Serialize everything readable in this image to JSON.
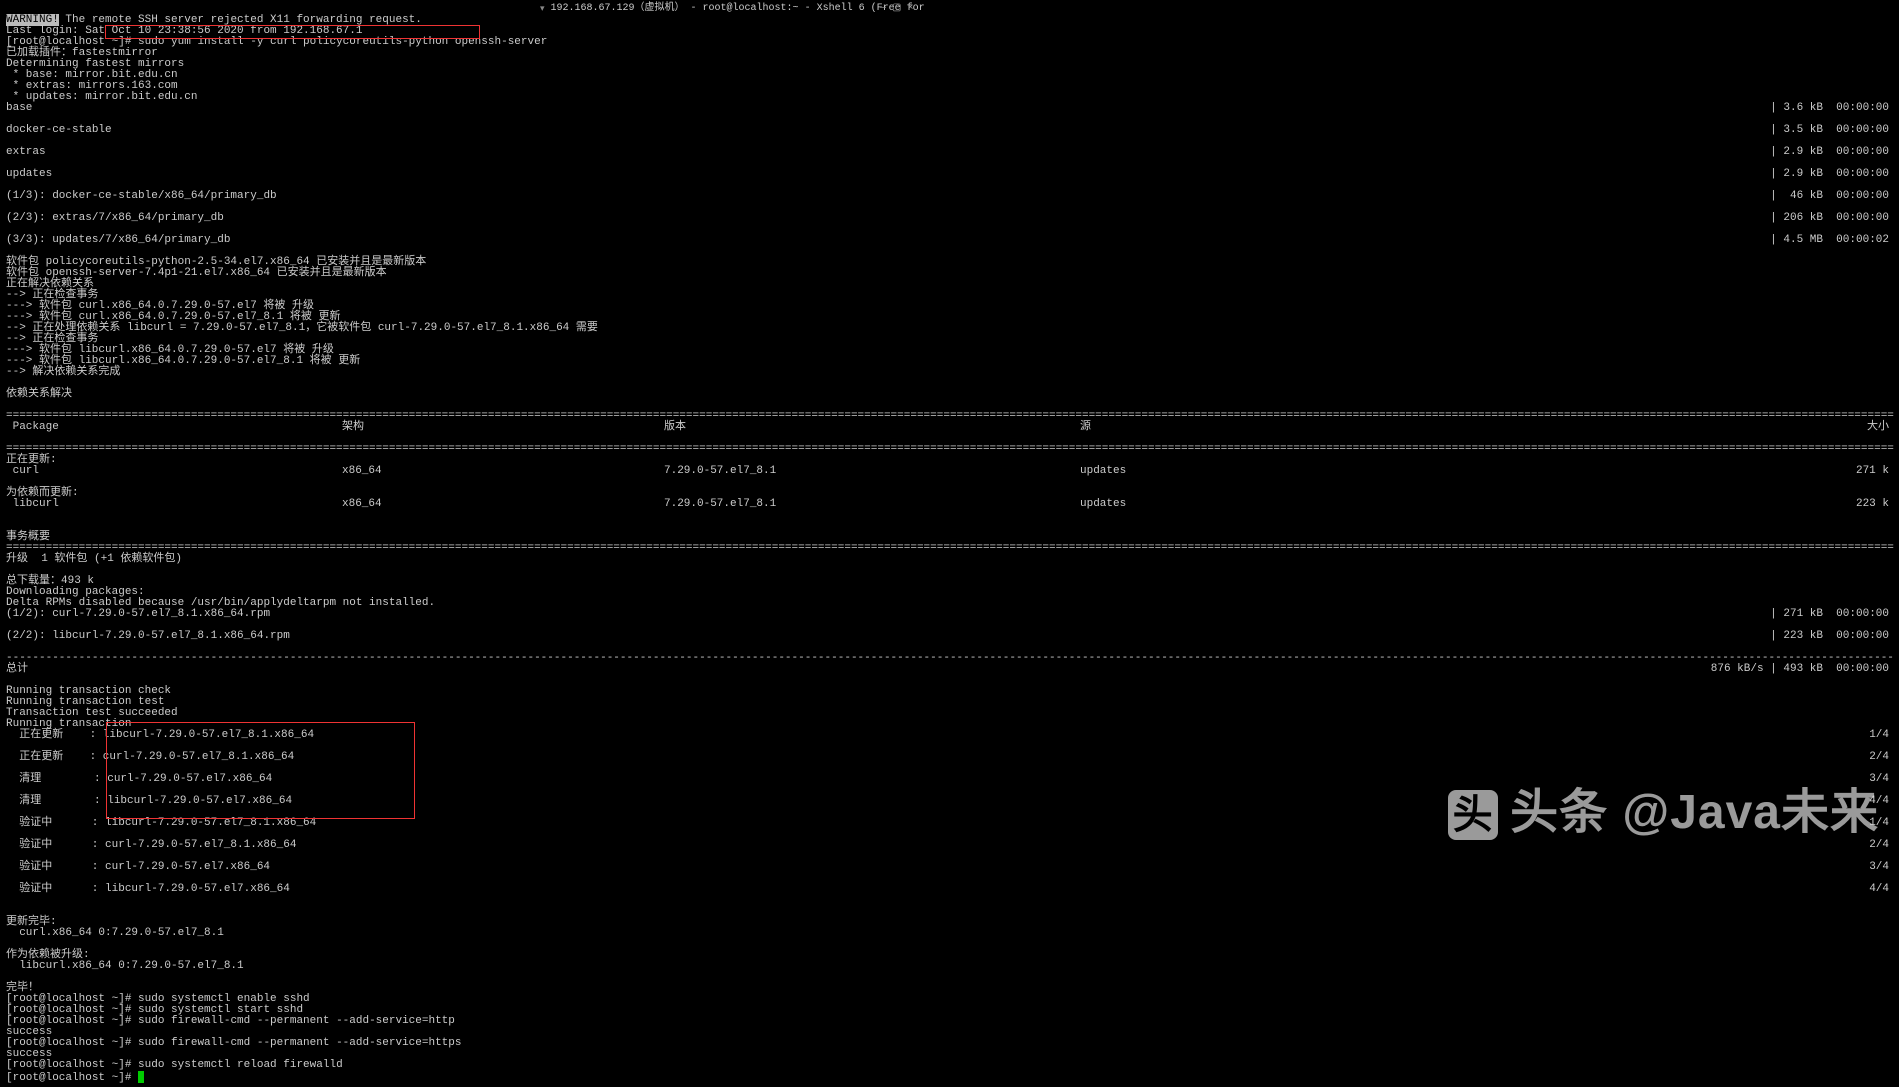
{
  "titlebar": {
    "host": "192.168.67.129（虚拟机） - root@localhost:~ - Xshell 6 (Free for"
  },
  "warn": "WARNING!",
  "lines": {
    "l0": " The remote SSH server rejected X11 forwarding request.",
    "l1": "Last login: Sat Oct 10 23:38:56 2020 from 192.168.67.1",
    "prompt0": "[root@localhost ~]# ",
    "cmd0": "sudo yum install -y curl policycoreutils-python openssh-server",
    "l3": "已加载插件：fastestmirror",
    "l4": "Determining fastest mirrors",
    "l5": " * base: mirror.bit.edu.cn",
    "l6": " * extras: mirrors.163.com",
    "l7": " * updates: mirror.bit.edu.cn",
    "l8": "base",
    "l8r": "| 3.6 kB  00:00:00",
    "l9": "docker-ce-stable",
    "l9r": "| 3.5 kB  00:00:00",
    "l10": "extras",
    "l10r": "| 2.9 kB  00:00:00",
    "l11": "updates",
    "l11r": "| 2.9 kB  00:00:00",
    "l12": "(1/3): docker-ce-stable/x86_64/primary_db",
    "l12r": "|  46 kB  00:00:00",
    "l13": "(2/3): extras/7/x86_64/primary_db",
    "l13r": "| 206 kB  00:00:00",
    "l14": "(3/3): updates/7/x86_64/primary_db",
    "l14r": "| 4.5 MB  00:00:02",
    "l15": "软件包 policycoreutils-python-2.5-34.el7.x86_64 已安装并且是最新版本",
    "l16": "软件包 openssh-server-7.4p1-21.el7.x86_64 已安装并且是最新版本",
    "l17": "正在解决依赖关系",
    "l18": "--> 正在检查事务",
    "l19": "---> 软件包 curl.x86_64.0.7.29.0-57.el7 将被 升级",
    "l20": "---> 软件包 curl.x86_64.0.7.29.0-57.el7_8.1 将被 更新",
    "l21": "--> 正在处理依赖关系 libcurl = 7.29.0-57.el7_8.1，它被软件包 curl-7.29.0-57.el7_8.1.x86_64 需要",
    "l22": "--> 正在检查事务",
    "l23": "---> 软件包 libcurl.x86_64.0.7.29.0-57.el7 将被 升级",
    "l24": "---> 软件包 libcurl.x86_64.0.7.29.0-57.el7_8.1 将被 更新",
    "l25": "--> 解决依赖关系完成",
    "l26": "依赖关系解决",
    "table": {
      "h_pkg": " Package",
      "h_arch": "架构",
      "h_ver": "版本",
      "h_src": "源",
      "h_size": "大小",
      "sec1": "正在更新:",
      "r1_pkg": " curl",
      "r1_arch": "x86_64",
      "r1_ver": "7.29.0-57.el7_8.1",
      "r1_src": "updates",
      "r1_size": "271 k",
      "sec2": "为依赖而更新:",
      "r2_pkg": " libcurl",
      "r2_arch": "x86_64",
      "r2_ver": "7.29.0-57.el7_8.1",
      "r2_src": "updates",
      "r2_size": "223 k"
    },
    "l30": "事务概要",
    "l31": "升级  1 软件包 (+1 依赖软件包)",
    "l32": "总下载量：493 k",
    "l33": "Downloading packages:",
    "l34": "Delta RPMs disabled because /usr/bin/applydeltarpm not installed.",
    "l35": "(1/2): curl-7.29.0-57.el7_8.1.x86_64.rpm",
    "l35r": "| 271 kB  00:00:00",
    "l36": "(2/2): libcurl-7.29.0-57.el7_8.1.x86_64.rpm",
    "l36r": "| 223 kB  00:00:00",
    "l37": "总计",
    "l37r": "876 kB/s | 493 kB  00:00:00",
    "l38": "Running transaction check",
    "l39": "Running transaction test",
    "l40": "Transaction test succeeded",
    "l41": "Running transaction",
    "l42": "  正在更新    : libcurl-7.29.0-57.el7_8.1.x86_64",
    "l42r": "1/4",
    "l43": "  正在更新    : curl-7.29.0-57.el7_8.1.x86_64",
    "l43r": "2/4",
    "l44": "  清理        : curl-7.29.0-57.el7.x86_64",
    "l44r": "3/4",
    "l45": "  清理        : libcurl-7.29.0-57.el7.x86_64",
    "l45r": "4/4",
    "l46": "  验证中      : libcurl-7.29.0-57.el7_8.1.x86_64",
    "l46r": "1/4",
    "l47": "  验证中      : curl-7.29.0-57.el7_8.1.x86_64",
    "l47r": "2/4",
    "l48": "  验证中      : curl-7.29.0-57.el7.x86_64",
    "l48r": "3/4",
    "l49": "  验证中      : libcurl-7.29.0-57.el7.x86_64",
    "l49r": "4/4",
    "l50": "更新完毕:",
    "l51": "  curl.x86_64 0:7.29.0-57.el7_8.1",
    "l52": "作为依赖被升级:",
    "l53": "  libcurl.x86_64 0:7.29.0-57.el7_8.1",
    "l54": "完毕！",
    "prompt1": "[root@localhost ~]# ",
    "cmd1": "sudo systemctl enable sshd",
    "cmd2": "sudo systemctl start sshd",
    "cmd3": "sudo firewall-cmd --permanent --add-service=http",
    "l55": "success",
    "cmd4": "sudo firewall-cmd --permanent --add-service=https",
    "cmd5": "sudo systemctl reload firewalld"
  },
  "watermark": {
    "icon": "头",
    "text": "头条 @Java未来"
  }
}
